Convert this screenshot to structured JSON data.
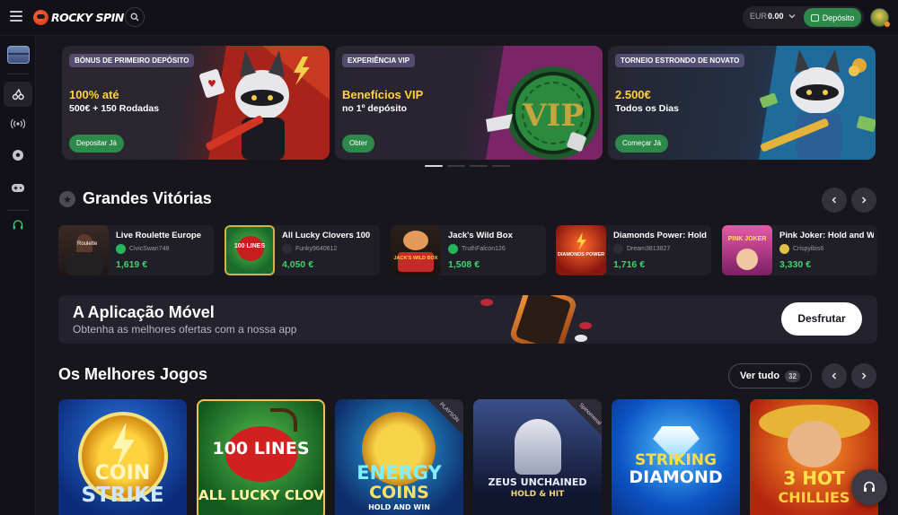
{
  "header": {
    "logo_text": "ROCKY SPIN",
    "wallet_currency": "EUR",
    "wallet_amount": "0.00",
    "deposit_label": "Depósito"
  },
  "promos": [
    {
      "tag": "BÓNUS DE PRIMEIRO DEPÓSITO",
      "title": "100% até",
      "subtitle": "500€ + 150 Rodadas",
      "button": "Depositar Já"
    },
    {
      "tag": "EXPERIÊNCIA VIP",
      "title": "Benefícios VIP",
      "subtitle": "no 1º depósito",
      "button": "Obter"
    },
    {
      "tag": "TORNEIO ESTRONDO DE NOVATO",
      "title": "2.500€",
      "subtitle": "Todos os Dias",
      "button": "Começar Já"
    }
  ],
  "vip_art_text": "VIP",
  "big_wins": {
    "title": "Grandes Vitórias",
    "items": [
      {
        "game": "Live Roulette Europe",
        "user": "CivicSwan748",
        "amount": "1,619 €",
        "thumb": "Roulette"
      },
      {
        "game": "All Lucky Clovers 100",
        "user": "Funky9640612",
        "amount": "4,050 €",
        "thumb": "100 LINES"
      },
      {
        "game": "Jack's Wild Box",
        "user": "TruthFalcon126",
        "amount": "1,508 €",
        "thumb": "JACK'S WILD BOX"
      },
      {
        "game": "Diamonds Power: Hold",
        "user": "Dream3813827",
        "amount": "1,716 €",
        "thumb": "DIAMONDS POWER"
      },
      {
        "game": "Pink Joker: Hold and W",
        "user": "Crispyibis6",
        "amount": "3,330 €",
        "thumb": "PINK JOKER"
      }
    ]
  },
  "app_banner": {
    "title": "A Aplicação Móvel",
    "subtitle": "Obtenha as melhores ofertas com a nossa app",
    "button": "Desfrutar"
  },
  "best_games": {
    "title": "Os Melhores Jogos",
    "view_all": "Ver tudo",
    "count": "32",
    "games": [
      {
        "line1": "COIN",
        "line2": "STRIKE"
      },
      {
        "line1": "100 LINES",
        "line2": "ALL LUCKY CLOVERS"
      },
      {
        "line1": "ENERGY",
        "line2": "COINS",
        "badge": "PLAYSON",
        "caption": "HOLD AND WIN"
      },
      {
        "line1": "ZEUS UNCHAINED",
        "line2": "HOLD & HIT",
        "badge": "Spinomenal"
      },
      {
        "line1": "STRIKING",
        "line2": "DIAMOND"
      },
      {
        "line1": "3 HOT",
        "line2": "CHILLIES"
      }
    ]
  },
  "colors": {
    "accent_green": "#2e8a4b",
    "win_green": "#45d16f",
    "promo_yellow": "#ffd23f"
  }
}
